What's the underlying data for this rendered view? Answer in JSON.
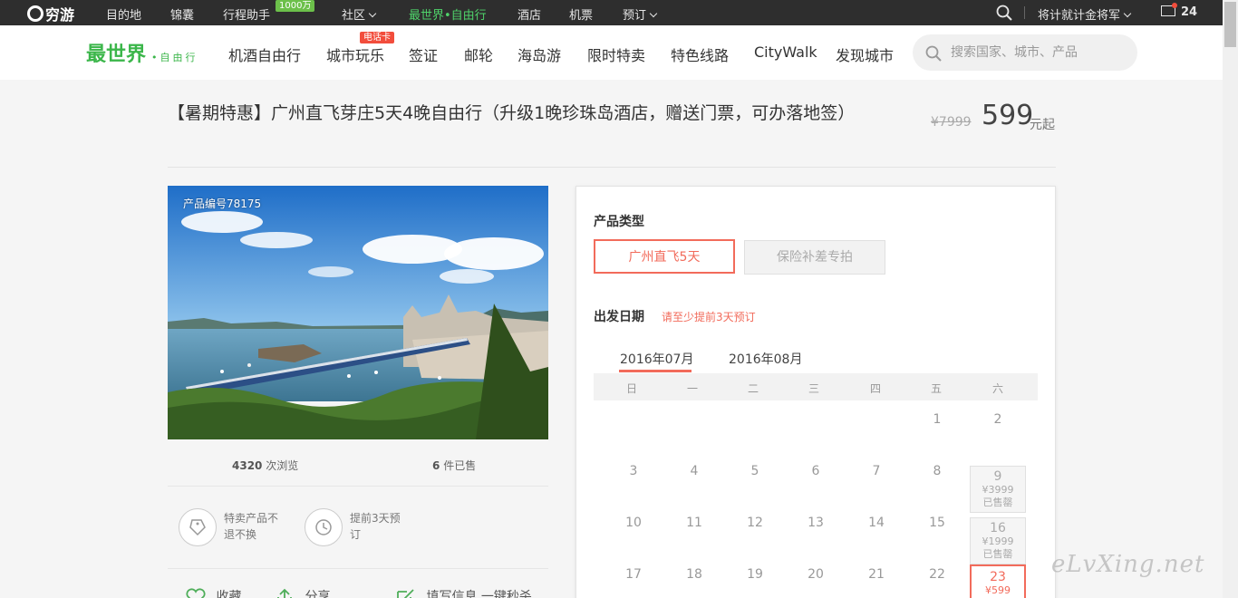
{
  "topbar": {
    "logo": "穷游",
    "items": [
      "目的地",
      "锦囊",
      "行程助手",
      "社区",
      "最世界•自由行",
      "酒店",
      "机票",
      "预订"
    ],
    "badge": "1000万",
    "username": "将计就计金将军",
    "mail_count": "24"
  },
  "navbar": {
    "brand_big": "最世界",
    "brand_small": "•自由行",
    "items": [
      "机酒自由行",
      "城市玩乐",
      "签证",
      "邮轮",
      "海岛游",
      "限时特卖",
      "特色线路",
      "CityWalk",
      "发现城市"
    ],
    "hot_tag": "电话卡",
    "search_placeholder": "搜索国家、城市、产品"
  },
  "product": {
    "title": "【暑期特惠】广州直飞芽庄5天4晚自由行（升级1晚珍珠岛酒店，赠送门票，可办落地签）",
    "old_price": "¥7999",
    "price": "599",
    "price_unit": "元起",
    "code": "产品编号78175",
    "views": "4320",
    "views_label": "次浏览",
    "sold": "6",
    "sold_label": "件已售",
    "features": [
      "特卖产品不退不换",
      "提前3天预订"
    ],
    "actions": [
      "收藏",
      "分享",
      "填写信息 一键秒杀"
    ]
  },
  "booking": {
    "type_label": "产品类型",
    "types": [
      "广州直飞5天",
      "保险补差专拍"
    ],
    "date_label": "出发日期",
    "date_warning": "请至少提前3天预订",
    "months": [
      "2016年07月",
      "2016年08月"
    ],
    "weekdays": [
      "日",
      "一",
      "二",
      "三",
      "四",
      "五",
      "六"
    ],
    "days": [
      {
        "num": "1"
      },
      {
        "num": "2"
      },
      {
        "num": "3"
      },
      {
        "num": "4"
      },
      {
        "num": "5"
      },
      {
        "num": "6"
      },
      {
        "num": "7"
      },
      {
        "num": "8"
      },
      {
        "num": "9",
        "price": "¥3999",
        "status": "已售罄"
      },
      {
        "num": "10"
      },
      {
        "num": "11"
      },
      {
        "num": "12"
      },
      {
        "num": "13"
      },
      {
        "num": "14"
      },
      {
        "num": "15"
      },
      {
        "num": "16",
        "price": "¥1999",
        "status": "已售罄"
      },
      {
        "num": "17"
      },
      {
        "num": "18"
      },
      {
        "num": "19"
      },
      {
        "num": "20"
      },
      {
        "num": "21"
      },
      {
        "num": "22"
      },
      {
        "num": "23",
        "price": "¥599"
      }
    ]
  },
  "watermark": "eLvXing.net",
  "colors": {
    "accent": "#f26b5b",
    "brand_green": "#3bb64a",
    "topbar": "#2e2e2e"
  }
}
